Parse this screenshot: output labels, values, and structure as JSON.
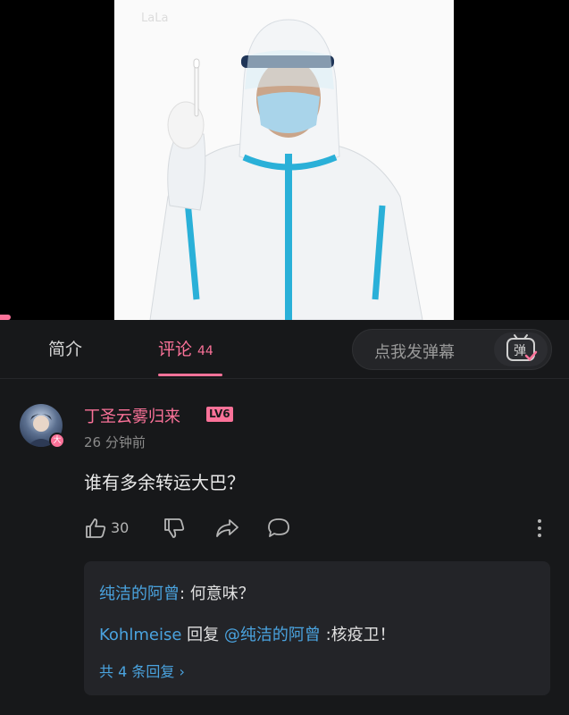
{
  "video": {
    "watermark": "LaLa"
  },
  "tabs": {
    "intro_label": "简介",
    "comments_label": "评论",
    "comments_count": "44",
    "danmaku_placeholder": "点我发弹幕",
    "danmaku_button": "弹"
  },
  "comment": {
    "username": "丁圣云雾归来",
    "level": "LV6",
    "avatar_badge": "大",
    "time": "26 分钟前",
    "content": "谁有多余转运大巴？",
    "like_count": "30"
  },
  "replies": {
    "first_name": "纯洁的阿曾",
    "first_text": ": 何意味？",
    "second_name": "Kohlmeise",
    "second_mid": " 回复 ",
    "second_mention": "@纯洁的阿曾",
    "second_text": " :核疫卫！",
    "total": "共 4 条回复 ›"
  },
  "colors": {
    "accent": "#fb7299",
    "link": "#4aa3df",
    "background": "#17181a"
  }
}
